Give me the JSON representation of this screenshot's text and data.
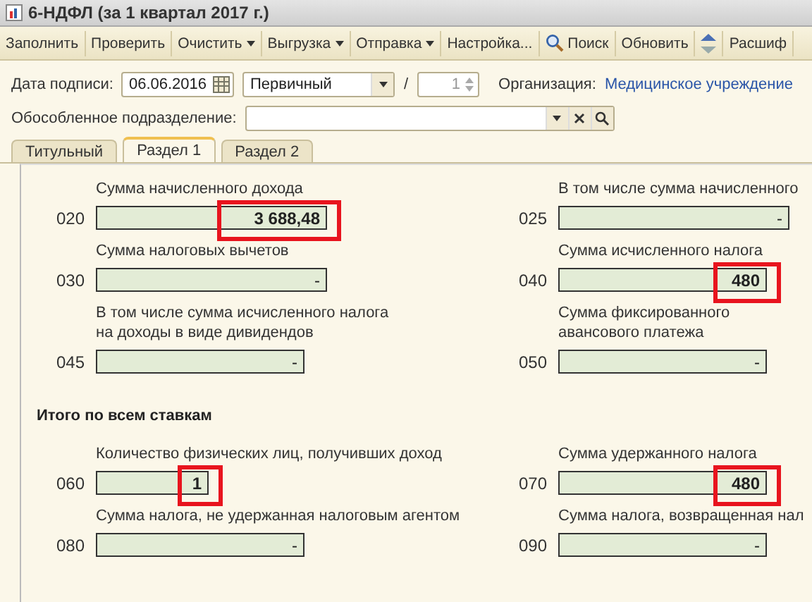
{
  "window": {
    "title": "6-НДФЛ (за 1 квартал 2017 г.)"
  },
  "toolbar": [
    {
      "kind": "button",
      "label": "Заполнить"
    },
    {
      "kind": "button",
      "label": "Проверить"
    },
    {
      "kind": "dropdown",
      "label": "Очистить"
    },
    {
      "kind": "dropdown",
      "label": "Выгрузка"
    },
    {
      "kind": "dropdown",
      "label": "Отправка"
    },
    {
      "kind": "button",
      "label": "Настройка..."
    },
    {
      "kind": "search",
      "label": "Поиск"
    },
    {
      "kind": "button",
      "label": "Обновить"
    },
    {
      "kind": "icon"
    },
    {
      "kind": "button",
      "label": "Расшиф"
    }
  ],
  "header": {
    "date_label": "Дата подписи:",
    "date": "06.06.2016",
    "type": "Первичный",
    "separator": "/",
    "correction": "1",
    "org_label": "Организация:",
    "org": "Медицинское учреждение",
    "division_label": "Обособленное подразделение:"
  },
  "tabs": [
    {
      "label": "Титульный",
      "selected": false
    },
    {
      "label": "Раздел 1",
      "selected": true
    },
    {
      "label": "Раздел 2",
      "selected": false
    }
  ],
  "rows": [
    {
      "kind": "pair",
      "left": {
        "code": "020",
        "label": "Сумма начисленного дохода",
        "value": "3 688,48",
        "highlighted": true
      },
      "right": {
        "code": "025",
        "label": "В том числе сумма начисленного",
        "value": "-",
        "highlighted": false
      }
    },
    {
      "kind": "pair",
      "left": {
        "code": "030",
        "label": "Сумма налоговых вычетов",
        "value": "-",
        "highlighted": false
      },
      "right": {
        "code": "040",
        "label": "Сумма исчисленного налога",
        "value": "480",
        "highlighted": true
      }
    },
    {
      "kind": "pair",
      "left": {
        "code": "045",
        "label": "В том числе сумма исчисленного налога на доходы в виде дивидендов",
        "value": "-",
        "highlighted": false
      },
      "right": {
        "code": "050",
        "label": "Сумма фиксированного авансового платежа",
        "value": "-",
        "highlighted": false
      }
    },
    {
      "kind": "heading",
      "text": "Итого по всем ставкам"
    },
    {
      "kind": "pair",
      "left": {
        "code": "060",
        "label": "Количество физических лиц, получивших доход",
        "value": "1",
        "highlighted": true
      },
      "right": {
        "code": "070",
        "label": "Сумма удержанного налога",
        "value": "480",
        "highlighted": true
      }
    },
    {
      "kind": "pair",
      "left": {
        "code": "080",
        "label": "Сумма налога, не удержанная налоговым агентом",
        "value": "-",
        "highlighted": false
      },
      "right": {
        "code": "090",
        "label": "Сумма налога, возвращенная нал",
        "value": "-",
        "highlighted": false
      }
    }
  ]
}
